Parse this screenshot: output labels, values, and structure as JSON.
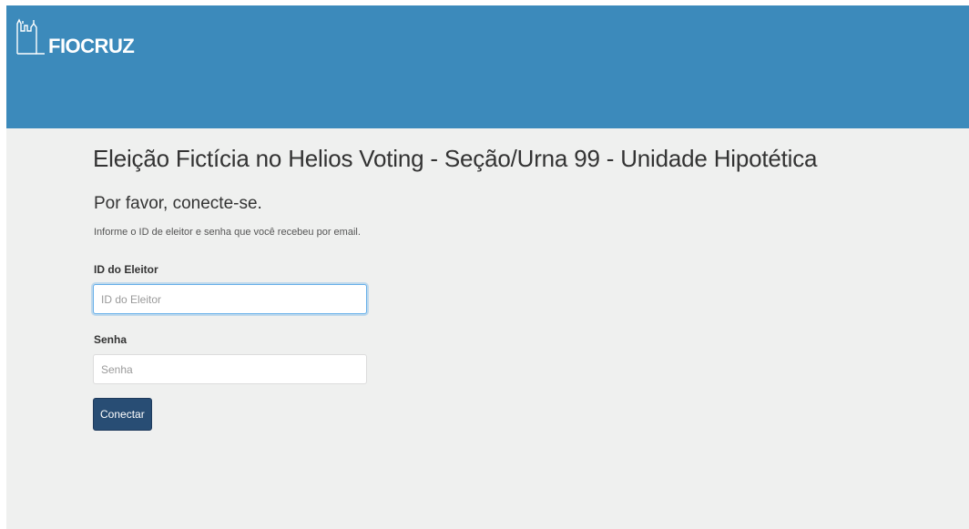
{
  "header": {
    "brand": "FIOCRUZ",
    "logo_icon": "fiocruz-castle-logo-icon",
    "background_color": "#3c8abb"
  },
  "main": {
    "title": "Eleição Fictícia no Helios Voting - Seção/Urna 99 - Unidade Hipotética",
    "subtitle": "Por favor, conecte-se.",
    "help_text": "Informe o ID de eleitor e senha que você recebeu por email."
  },
  "form": {
    "voter_id": {
      "label": "ID do Eleitor",
      "placeholder": "ID do Eleitor",
      "value": ""
    },
    "password": {
      "label": "Senha",
      "placeholder": "Senha",
      "value": ""
    },
    "submit_label": "Conectar",
    "button_color": "#284d74"
  }
}
